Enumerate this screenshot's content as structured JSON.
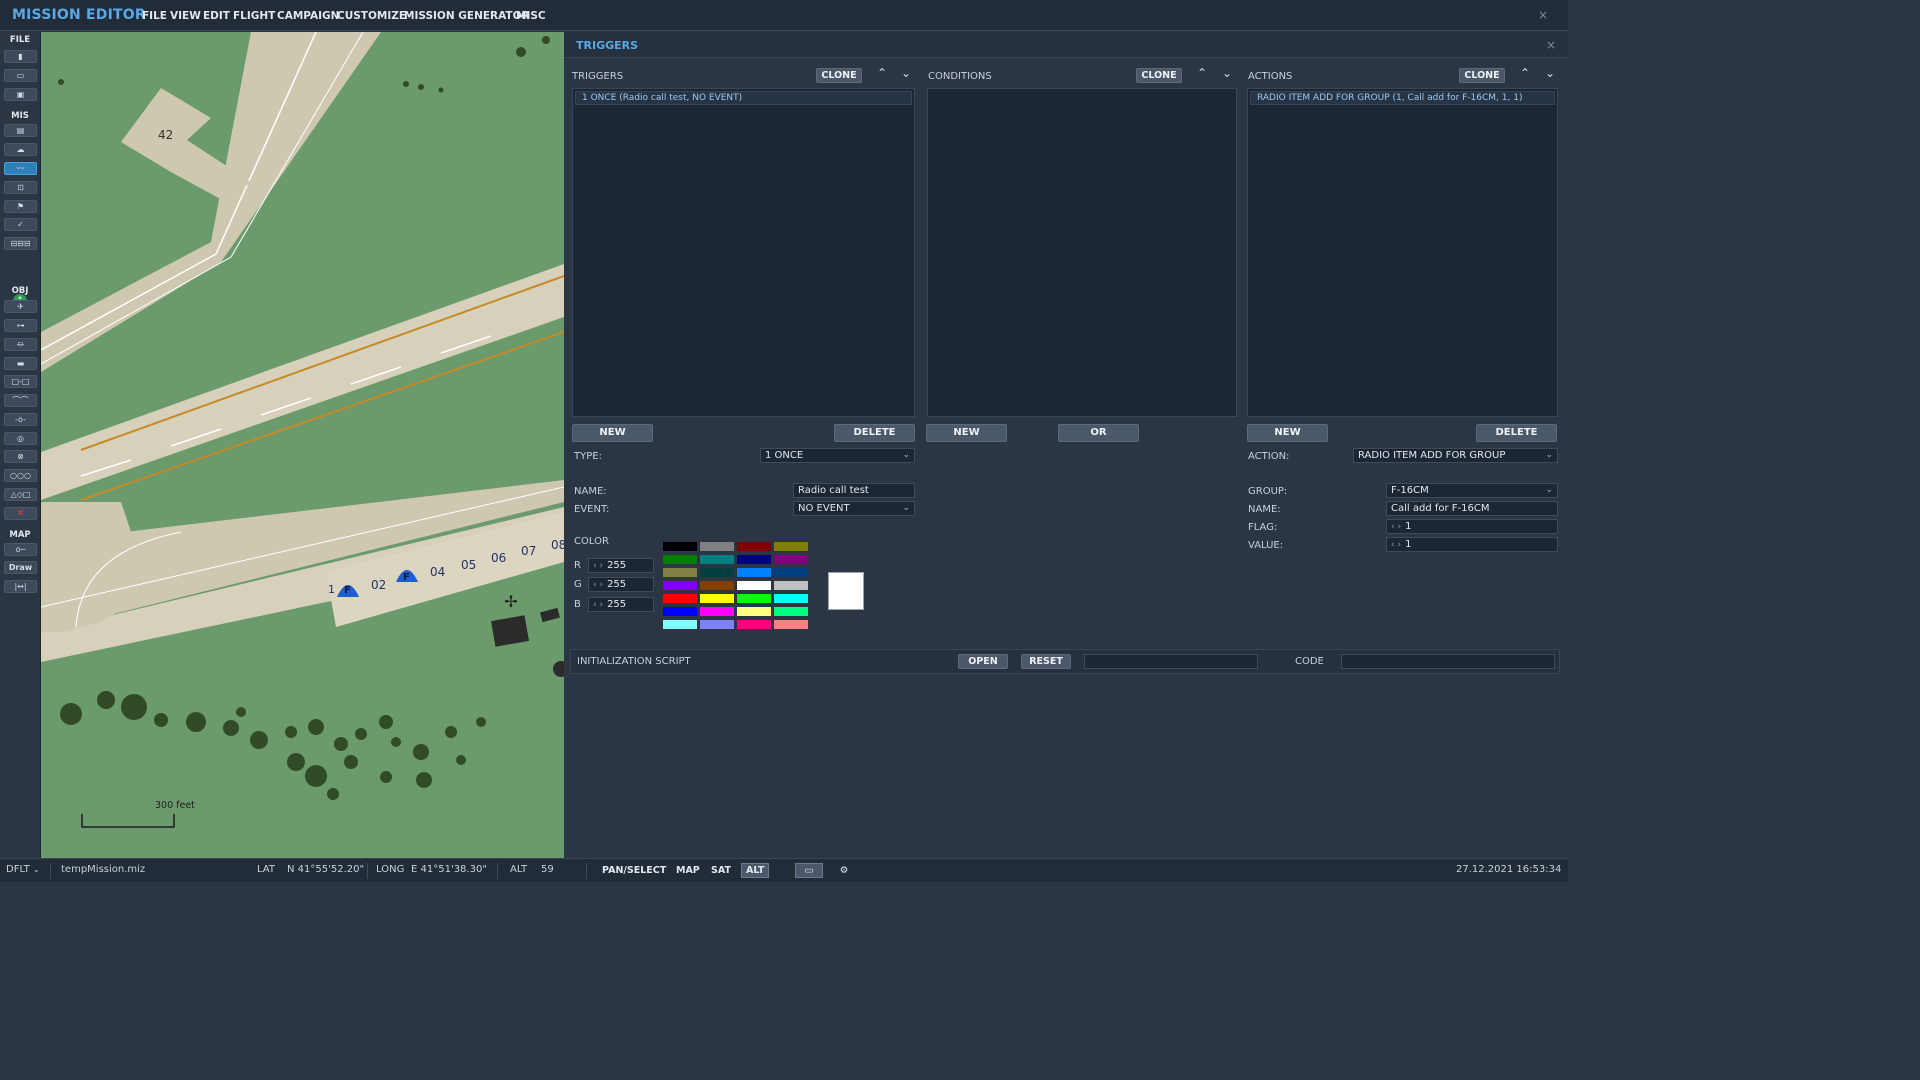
{
  "app": {
    "title": "MISSION EDITOR",
    "close_icon": "×"
  },
  "menu": [
    "FILE",
    "VIEW",
    "EDIT",
    "FLIGHT",
    "CAMPAIGN",
    "CUSTOMIZE",
    "MISSION GENERATOR",
    "MISC"
  ],
  "toolbar": {
    "sections": [
      "FILE",
      "MIS",
      "OBJ",
      "MAP"
    ],
    "draw_label": "Draw",
    "delete_glyph": "✕"
  },
  "map": {
    "labels": [
      "42",
      "1",
      "02",
      "04",
      "05",
      "06",
      "07",
      "08"
    ],
    "shelter_letter": "F",
    "scale_label": "300 feet"
  },
  "panel": {
    "title": "TRIGGERS",
    "close_icon": "×",
    "triggers": {
      "label": "TRIGGERS",
      "clone": "CLONE",
      "items": [
        "1 ONCE (Radio call test, NO EVENT)"
      ],
      "new": "NEW",
      "delete": "DELETE"
    },
    "conditions": {
      "label": "CONDITIONS",
      "clone": "CLONE",
      "new": "NEW",
      "or": "OR"
    },
    "actions": {
      "label": "ACTIONS",
      "clone": "CLONE",
      "items": [
        "RADIO ITEM ADD FOR GROUP (1, Call add for F-16CM, 1, 1)"
      ],
      "new": "NEW",
      "delete": "DELETE"
    },
    "type_label": "TYPE:",
    "type_value": "1 ONCE",
    "name_label": "NAME:",
    "name_value": "Radio call test",
    "event_label": "EVENT:",
    "event_value": "NO EVENT",
    "color": {
      "label": "COLOR",
      "r_label": "R",
      "r": "255",
      "g_label": "G",
      "g": "255",
      "b_label": "B",
      "b": "255",
      "swatches": [
        "#000000",
        "#808080",
        "#800000",
        "#808000",
        "#008000",
        "#008080",
        "#000080",
        "#800080",
        "#808040",
        "#004040",
        "#0080ff",
        "#004080",
        "#8000ff",
        "#804000",
        "#ffffff",
        "#c0c0c0",
        "#ff0000",
        "#ffff00",
        "#00ff00",
        "#00ffff",
        "#0000ff",
        "#ff00ff",
        "#ffff80",
        "#00ff80",
        "#80ffff",
        "#8080ff",
        "#ff0080",
        "#ff8080"
      ],
      "preview": "#ffffff"
    },
    "action_label": "ACTION:",
    "action_value": "RADIO ITEM ADD FOR GROUP",
    "group_label": "GROUP:",
    "group_value": "F-16CM",
    "action_name_label": "NAME:",
    "action_name_value": "Call add for F-16CM",
    "flag_label": "FLAG:",
    "flag_value": "1",
    "value_label": "VALUE:",
    "value_value": "1",
    "script": {
      "label": "INITIALIZATION SCRIPT",
      "open": "OPEN",
      "reset": "RESET",
      "code_label": "CODE",
      "path_value": "",
      "code_value": ""
    }
  },
  "status": {
    "profile": "DFLT",
    "file": "tempMission.miz",
    "lat_label": "LAT",
    "lat": "N 41°55'52.20\"",
    "long_label": "LONG",
    "long": "E 41°51'38.30\"",
    "alt_label": "ALT",
    "alt": "59",
    "pan_select": "PAN/SELECT",
    "map": "MAP",
    "sat": "SAT",
    "alt_btn": "ALT",
    "datetime": "27.12.2021 16:53:34"
  }
}
